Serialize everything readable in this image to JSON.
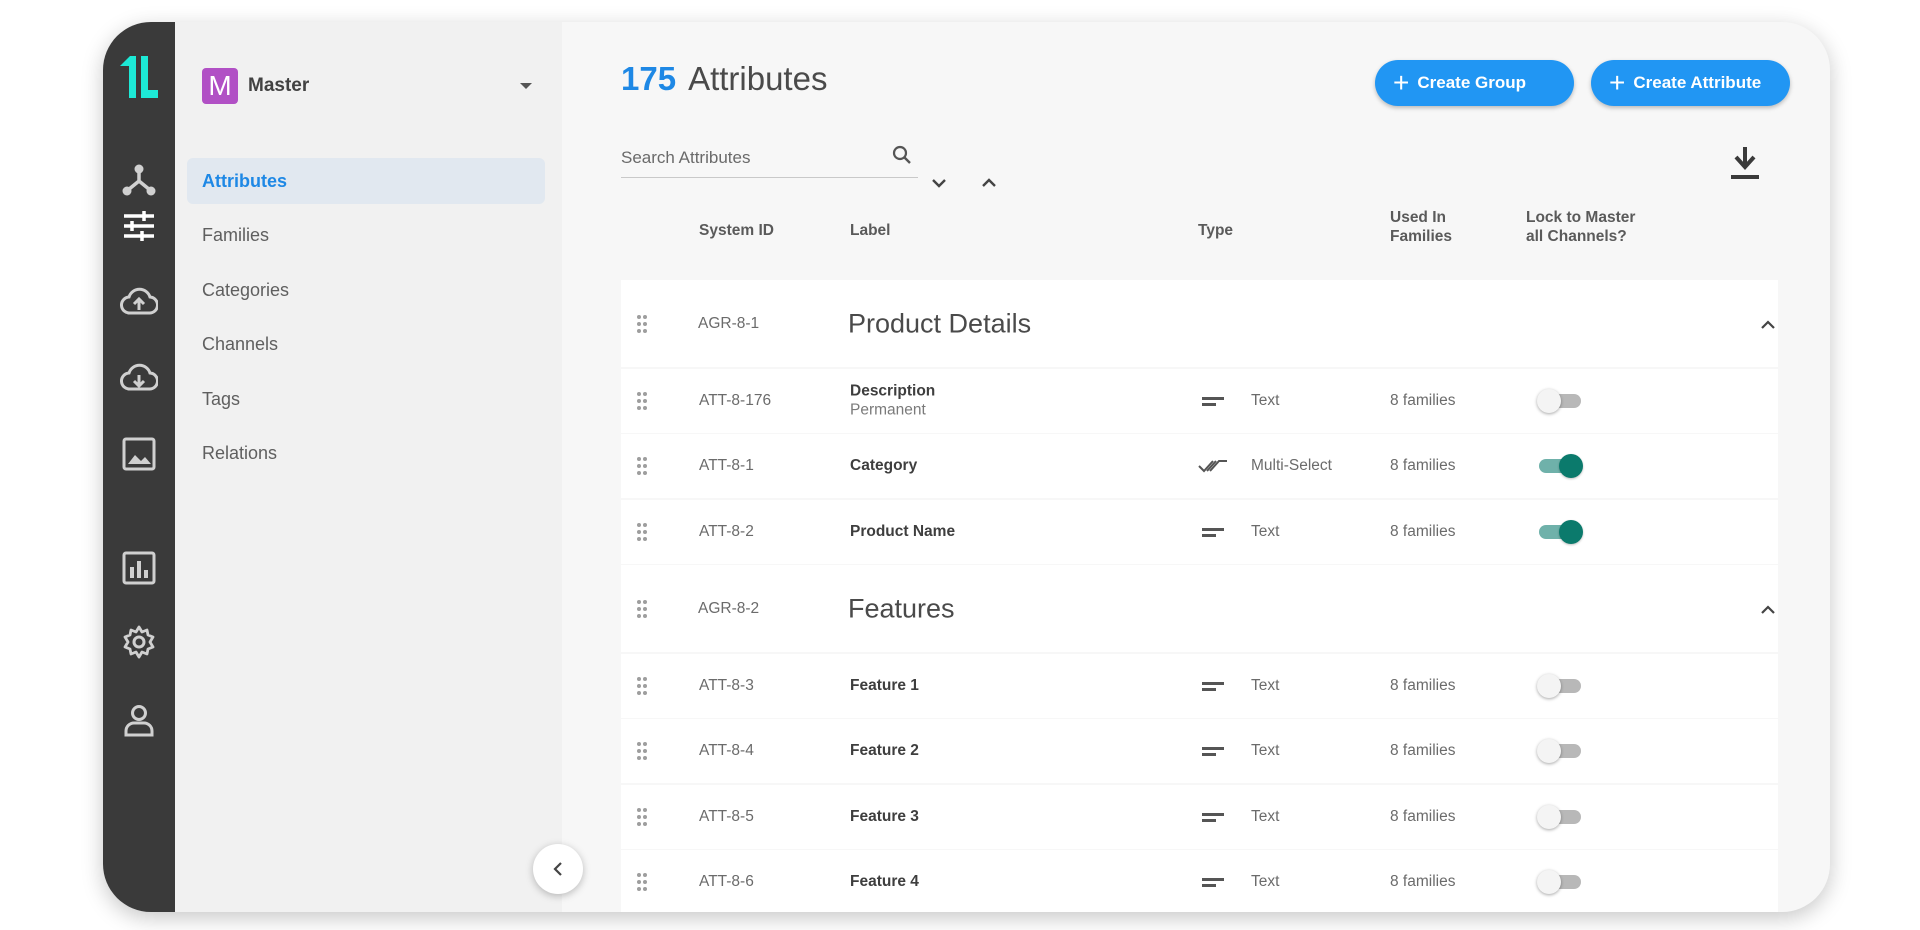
{
  "workspace": {
    "initial": "M",
    "name": "Master",
    "badge_color": "#b150c5"
  },
  "rail": {
    "icons": [
      "logo-icon",
      "network-icon",
      "sliders-icon",
      "cloud-upload-icon",
      "cloud-download-icon",
      "image-icon",
      "chart-icon",
      "gear-icon",
      "user-icon"
    ]
  },
  "sidebar": {
    "items": [
      {
        "label": "Attributes",
        "active": true
      },
      {
        "label": "Families"
      },
      {
        "label": "Categories"
      },
      {
        "label": "Channels"
      },
      {
        "label": "Tags"
      },
      {
        "label": "Relations"
      }
    ]
  },
  "header": {
    "count": "175",
    "title": "Attributes",
    "create_group_label": "Create Group",
    "create_attribute_label": "Create Attribute",
    "accent_color": "#2196f3"
  },
  "search": {
    "placeholder": "Search Attributes",
    "value": ""
  },
  "table": {
    "columns": {
      "system_id": "System ID",
      "label": "Label",
      "type": "Type",
      "used_in_1": "Used In",
      "used_in_2": "Families",
      "lock_1": "Lock to Master",
      "lock_2": "all Channels?"
    },
    "rows": [
      {
        "kind": "group",
        "id": "AGR-8-1",
        "label": "Product Details"
      },
      {
        "kind": "attr",
        "id": "ATT-8-176",
        "label": "Description",
        "sublabel": "Permanent",
        "type": "Text",
        "type_icon": "text-icon",
        "families": "8 families",
        "locked": false
      },
      {
        "kind": "attr",
        "id": "ATT-8-1",
        "label": "Category",
        "type": "Multi-Select",
        "type_icon": "multi-select-icon",
        "families": "8 families",
        "locked": true
      },
      {
        "kind": "attr",
        "id": "ATT-8-2",
        "label": "Product Name",
        "type": "Text",
        "type_icon": "text-icon",
        "families": "8 families",
        "locked": true
      },
      {
        "kind": "group",
        "id": "AGR-8-2",
        "label": "Features"
      },
      {
        "kind": "attr",
        "id": "ATT-8-3",
        "label": "Feature 1",
        "type": "Text",
        "type_icon": "text-icon",
        "families": "8 families",
        "locked": false
      },
      {
        "kind": "attr",
        "id": "ATT-8-4",
        "label": "Feature 2",
        "type": "Text",
        "type_icon": "text-icon",
        "families": "8 families",
        "locked": false
      },
      {
        "kind": "attr",
        "id": "ATT-8-5",
        "label": "Feature 3",
        "type": "Text",
        "type_icon": "text-icon",
        "families": "8 families",
        "locked": false
      },
      {
        "kind": "attr",
        "id": "ATT-8-6",
        "label": "Feature 4",
        "type": "Text",
        "type_icon": "text-icon",
        "families": "8 families",
        "locked": false
      }
    ]
  },
  "colors": {
    "toggle_on": "#0b7a6c",
    "rail_bg": "#3a3a3a",
    "logo": "#1de9d6"
  }
}
